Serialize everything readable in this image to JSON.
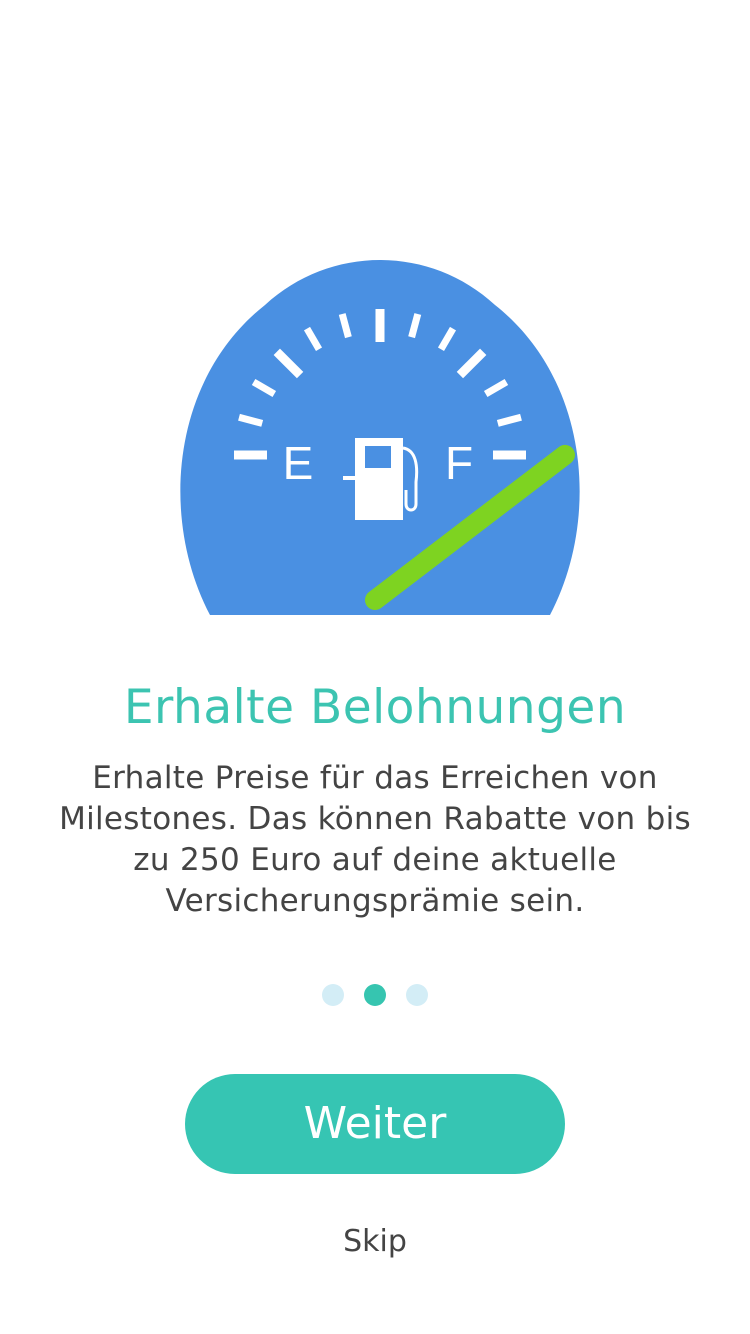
{
  "gauge": {
    "icon": "fuel-gauge-icon",
    "empty_label": "E",
    "full_label": "F",
    "level_fraction": 0.92,
    "colors": {
      "dial": "#4a90e2",
      "needle": "#7ed321",
      "marks": "#ffffff"
    }
  },
  "onboarding": {
    "title": "Erhalte Belohnungen",
    "description": "Erhalte Preise für das Erreichen von Milestones. Das können Rabatte von bis zu 250 Euro auf deine aktuelle Versicherungsprämie sein.",
    "page_indicator": {
      "total": 3,
      "current": 2
    },
    "next_label": "Weiter",
    "skip_label": "Skip"
  },
  "colors": {
    "accent": "#36c5b0",
    "dot_inactive": "#d3edf6",
    "text": "#444444"
  }
}
